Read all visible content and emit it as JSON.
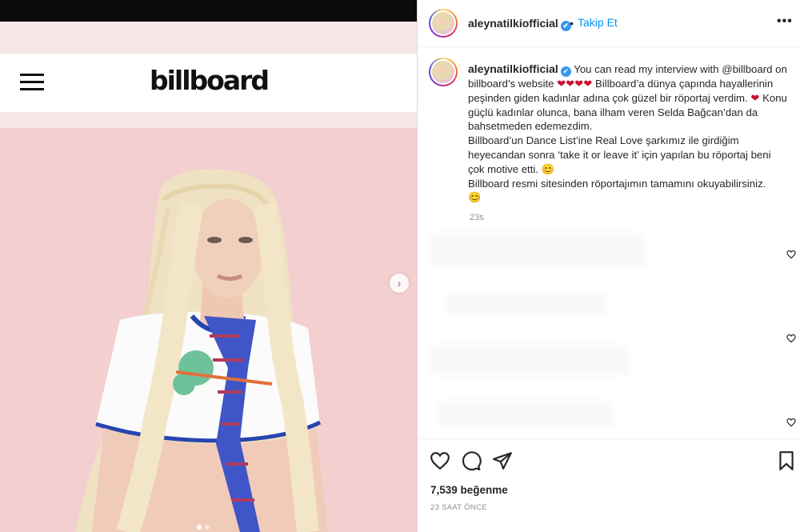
{
  "media": {
    "site_logo": "billboard",
    "next_icon": "chevron-right-icon",
    "menu_icon": "hamburger-menu-icon",
    "carousel": {
      "count": 2,
      "active": 1
    }
  },
  "post_header": {
    "username": "aleynatilkiofficial",
    "verified_icon": "✔",
    "separator": "•",
    "follow_label": "Takip Et",
    "more_label": "•••"
  },
  "caption": {
    "username": "aleynatilkiofficial",
    "verified_icon": "✔",
    "line1": " You can read my interview with @billboard on billboard’s website ",
    "hearts1": "❤❤❤❤",
    "line2": " Billboard’a dünya çapında hayallerinin peşinden giden kadınlar adına çok güzel bir röportaj verdim. ",
    "heart2": "❤",
    "line3": " Konu güçlü kadınlar olunca, bana ilham veren Selda Bağcan’dan da bahsetmeden edemezdim.",
    "line4": "Billboard’un Dance List’ine Real Love şarkımız ile girdiğim heyecandan sonra ‘take it or leave it’ için yapılan bu röportaj beni çok motive etti. ",
    "emoji1": "😊",
    "line5": "Billboard resmi sitesinden röportajımın tamamını okuyabilirsiniz.",
    "emoji2": "😊",
    "time_ago": "23s"
  },
  "actions": {
    "like_icon": "heart-outline-icon",
    "comment_icon": "comment-icon",
    "share_icon": "paper-plane-icon",
    "save_icon": "bookmark-icon",
    "likes_text": "7,539 beğenme",
    "timestamp": "23 SAAT ÖNCE"
  },
  "colors": {
    "link_blue": "#0095f6",
    "verified_blue": "#3897f0",
    "photo_background": "#f3cfd0"
  }
}
